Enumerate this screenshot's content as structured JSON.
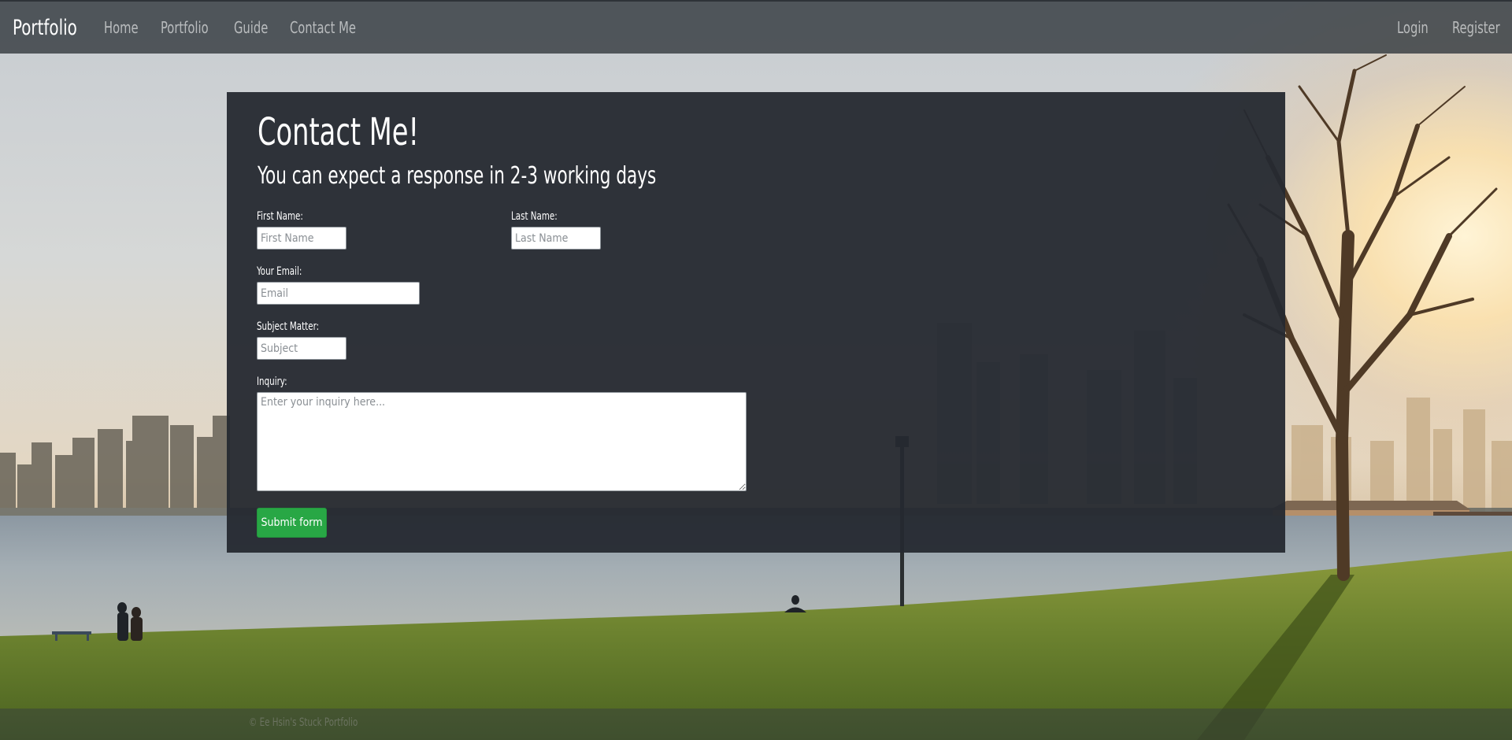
{
  "navbar": {
    "brand": "Portfolio",
    "left_links": [
      "Home",
      "Portfolio",
      "Guide",
      "Contact Me"
    ],
    "right_links": [
      "Login",
      "Register"
    ]
  },
  "contact": {
    "title": "Contact Me!",
    "subtitle": "You can expect a response in 2-3 working days",
    "first_name": {
      "label": "First Name:",
      "placeholder": "First Name"
    },
    "last_name": {
      "label": "Last Name:",
      "placeholder": "Last Name"
    },
    "email": {
      "label": "Your Email:",
      "placeholder": "Email"
    },
    "subject": {
      "label": "Subject Matter:",
      "placeholder": "Subject"
    },
    "inquiry": {
      "label": "Inquiry:",
      "placeholder": "Enter your inquiry here..."
    },
    "submit_label": "Submit form"
  },
  "footer": {
    "text": "© Ee Hsin's Stuck Portfolio"
  }
}
